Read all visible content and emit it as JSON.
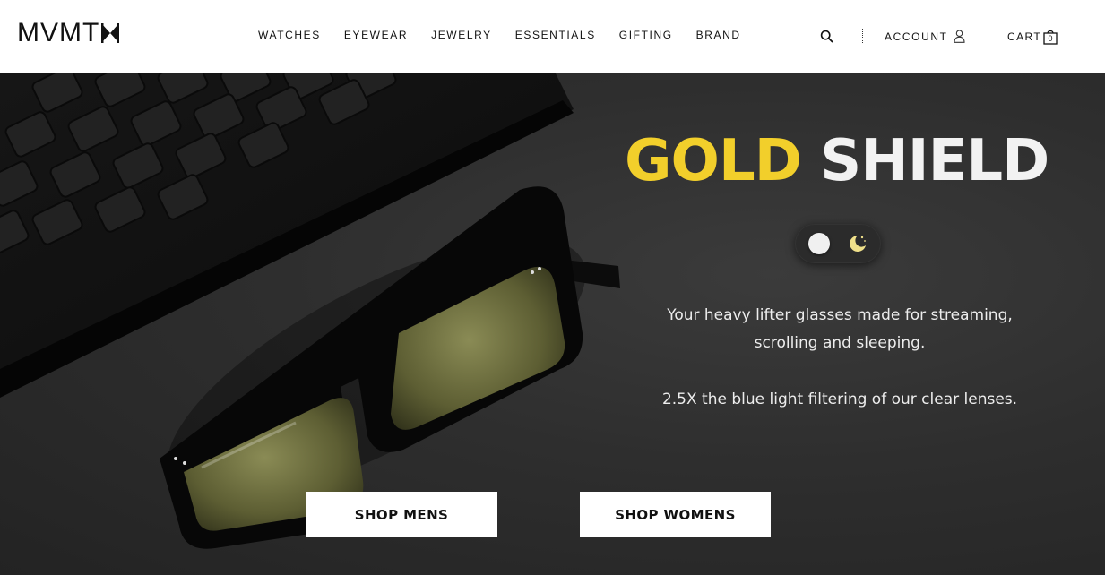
{
  "brand": {
    "logo_text": "MVMT"
  },
  "nav": {
    "items": [
      {
        "label": "WATCHES"
      },
      {
        "label": "EYEWEAR"
      },
      {
        "label": "JEWELRY"
      },
      {
        "label": "ESSENTIALS"
      },
      {
        "label": "GIFTING"
      },
      {
        "label": "BRAND"
      }
    ]
  },
  "utils": {
    "search_icon": "search-icon",
    "account_label": "ACCOUNT",
    "account_icon": "user-icon",
    "cart_label": "CART",
    "cart_icon": "shopping-bag-icon",
    "cart_count": "0"
  },
  "hero": {
    "headline_gold": "GOLD",
    "headline_white": "SHIELD",
    "toggle": {
      "day_icon": "sun-dot-icon",
      "night_icon": "moon-stars-icon",
      "selected": "day"
    },
    "copy_line_1": "Your heavy lifter glasses made for streaming,",
    "copy_line_2": "scrolling and sleeping.",
    "copy_line_3": "2.5X the blue light filtering of our clear lenses.",
    "cta_mens": "SHOP MENS",
    "cta_womens": "SHOP WOMENS"
  },
  "colors": {
    "gold": "#f2cf2b",
    "hero_bg": "#2e2e2e",
    "text_dark": "#111111",
    "button_bg": "#ffffff"
  }
}
